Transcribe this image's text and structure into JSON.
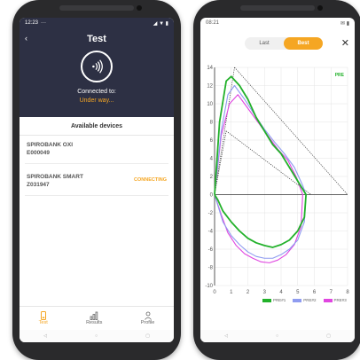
{
  "left_screen": {
    "status": {
      "time": "12:23",
      "dots": "···",
      "icons": "◢ ▼ ▮"
    },
    "back_icon": "‹",
    "title": "Test",
    "connected_to": "Connected to:",
    "state": "Under way...",
    "section_title": "Available devices",
    "devices": [
      {
        "name": "SPIROBANK OXI",
        "serial": "E000049",
        "badge": ""
      },
      {
        "name": "SPIROBANK SMART",
        "serial": "Z031947",
        "badge": "CONNECTING"
      }
    ],
    "nav": [
      {
        "label": "Test",
        "icon": "phone-icon",
        "active": true
      },
      {
        "label": "Results",
        "icon": "bar-chart-icon",
        "active": false
      },
      {
        "label": "Profile",
        "icon": "person-icon",
        "active": false
      }
    ],
    "softkeys": [
      "◁",
      "○",
      "▢"
    ]
  },
  "right_screen": {
    "status": {
      "time": "08:21",
      "icons": "✉ ▮"
    },
    "toggle": {
      "last": "Last",
      "best": "Best"
    },
    "close_icon": "✕",
    "colors": {
      "accent": "#f5a623",
      "green": "#22b12a",
      "blue": "#8f9cf0",
      "magenta": "#e046e0"
    },
    "softkeys": [
      "◁",
      "○",
      "▢"
    ]
  },
  "chart_data": {
    "type": "line",
    "xlim": [
      0,
      8
    ],
    "ylim": [
      -10,
      14
    ],
    "x_ticks": [
      0,
      1,
      2,
      3,
      4,
      5,
      6,
      7,
      8
    ],
    "y_ticks": [
      14,
      12,
      10,
      8,
      6,
      4,
      2,
      0,
      -2,
      -4,
      -6,
      -8,
      -10
    ],
    "grid": true,
    "corner_label": "PRE",
    "legend": [
      "PRE#1",
      "PRE#2",
      "PRE#3"
    ],
    "series": [
      {
        "name": "PRE#1",
        "color": "#22b12a",
        "x": [
          0,
          0.3,
          0.7,
          1.0,
          1.5,
          2.0,
          2.5,
          3.0,
          3.5,
          4.0,
          4.5,
          5.0,
          5.5,
          5.4,
          5.0,
          4.5,
          4.0,
          3.5,
          3.0,
          2.5,
          2.0,
          1.5,
          1.0,
          0.5,
          0.2,
          0
        ],
        "y": [
          0,
          8,
          12.5,
          13,
          12,
          10.5,
          8.5,
          7,
          5.5,
          4.5,
          3,
          1.5,
          0,
          -2.5,
          -4,
          -5,
          -5.5,
          -5.8,
          -5.6,
          -5.3,
          -4.8,
          -4,
          -3,
          -1.8,
          -0.6,
          0
        ]
      },
      {
        "name": "PRE#2",
        "color": "#8f9cf0",
        "x": [
          0,
          0.4,
          0.8,
          1.2,
          1.8,
          2.4,
          3.0,
          3.6,
          4.2,
          4.8,
          5.3,
          5.5,
          5.4,
          5.0,
          4.5,
          4.0,
          3.5,
          3.0,
          2.5,
          2.0,
          1.5,
          1.0,
          0.5,
          0.2,
          0
        ],
        "y": [
          0,
          7,
          11,
          12,
          10.5,
          8.8,
          7.2,
          5.8,
          4.5,
          3,
          1,
          0,
          -3,
          -5,
          -6,
          -6.6,
          -7,
          -7,
          -6.8,
          -6.3,
          -5.5,
          -4.5,
          -3,
          -1.2,
          0
        ]
      },
      {
        "name": "PRE#3",
        "color": "#e046e0",
        "x": [
          0,
          0.4,
          0.9,
          1.4,
          2.0,
          2.6,
          3.2,
          3.8,
          4.4,
          4.9,
          5.3,
          5.2,
          4.8,
          4.3,
          3.8,
          3.3,
          2.8,
          2.3,
          1.8,
          1.3,
          0.8,
          0.4,
          0
        ],
        "y": [
          0,
          6.5,
          10,
          11,
          9.5,
          8,
          6.5,
          5,
          3.8,
          2,
          0,
          -3.5,
          -5.5,
          -6.6,
          -7.2,
          -7.5,
          -7.4,
          -7,
          -6.5,
          -5.6,
          -4.2,
          -2.2,
          0
        ]
      }
    ],
    "reference_lines": [
      {
        "x": [
          0,
          1.2
        ],
        "y": [
          0,
          14
        ]
      },
      {
        "x": [
          1.2,
          8
        ],
        "y": [
          14,
          0
        ]
      },
      {
        "x": [
          0,
          0.7
        ],
        "y": [
          0,
          7
        ]
      },
      {
        "x": [
          0.7,
          5.8
        ],
        "y": [
          7,
          0
        ]
      }
    ]
  }
}
